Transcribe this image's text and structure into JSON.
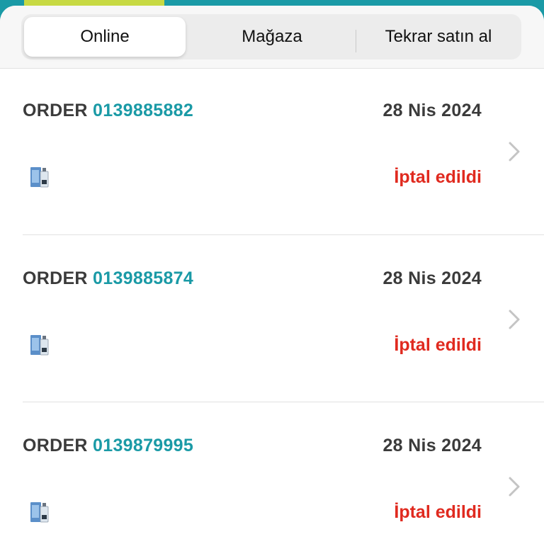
{
  "top_tab": {
    "label": ""
  },
  "tabs": [
    {
      "label": "Online",
      "active": true
    },
    {
      "label": "Mağaza",
      "active": false
    },
    {
      "label": "Tekrar satın al",
      "active": false
    }
  ],
  "orders": [
    {
      "prefix": "ORDER",
      "number": "0139885882",
      "date": "28 Nis 2024",
      "status": "İptal edildi",
      "product_icon": "perfume-bottle-icon"
    },
    {
      "prefix": "ORDER",
      "number": "0139885874",
      "date": "28 Nis 2024",
      "status": "İptal edildi",
      "product_icon": "perfume-bottle-icon"
    },
    {
      "prefix": "ORDER",
      "number": "0139879995",
      "date": "28 Nis 2024",
      "status": "İptal edildi",
      "product_icon": "perfume-bottle-icon"
    }
  ],
  "colors": {
    "accent": "#1a9aa6",
    "status_cancelled": "#e02a1f",
    "top_tab": "#c7d943"
  }
}
